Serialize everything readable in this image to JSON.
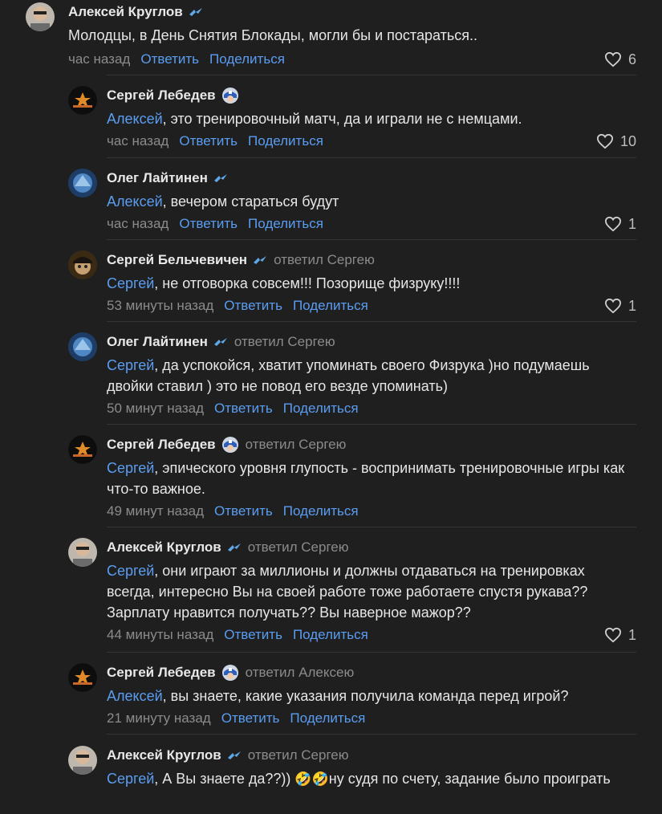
{
  "actions": {
    "reply": "Ответить",
    "share": "Поделиться"
  },
  "comments": [
    {
      "author": "Алексей Круглов",
      "badge": "zenit-icon",
      "replied_to": "",
      "mention": "",
      "text": "Молодцы, в День Снятия Блокады, могли бы и постараться..",
      "time": "час назад",
      "likes": "6"
    },
    {
      "author": "Сергей Лебедев",
      "badge": "captain-america-icon",
      "replied_to": "",
      "mention": "Алексей",
      "text": ", это тренировочный матч, да и играли не с немцами.",
      "time": "час назад",
      "likes": "10"
    },
    {
      "author": "Олег Лайтинен",
      "badge": "zenit-icon",
      "replied_to": "",
      "mention": "Алексей",
      "text": ", вечером стараться будут",
      "time": "час назад",
      "likes": "1"
    },
    {
      "author": "Сергей Бельчевичен",
      "badge": "zenit-icon",
      "replied_to": "ответил Сергею",
      "mention": "Сергей",
      "text": ", не отговорка совсем!!! Позорище физруку!!!!",
      "time": "53 минуты назад",
      "likes": "1"
    },
    {
      "author": "Олег Лайтинен",
      "badge": "zenit-icon",
      "replied_to": "ответил Сергею",
      "mention": "Сергей",
      "text": ", да успокойся, хватит упоминать своего Физрука )но подумаешь двойки ставил ) это не повод его везде упоминать)",
      "time": "50 минут назад",
      "likes": ""
    },
    {
      "author": "Сергей Лебедев",
      "badge": "captain-america-icon",
      "replied_to": "ответил Сергею",
      "mention": "Сергей",
      "text": ", эпического уровня глупость - воспринимать тренировочные игры как что-то важное.",
      "time": "49 минут назад",
      "likes": ""
    },
    {
      "author": "Алексей Круглов",
      "badge": "zenit-icon",
      "replied_to": "ответил Сергею",
      "mention": "Сергей",
      "text": ", они играют за миллионы и должны отдаваться на тренировках всегда, интересно Вы на своей работе тоже работаете спустя рукава?? Зарплату нравится получать?? Вы наверное мажор??",
      "time": "44 минуты назад",
      "likes": "1"
    },
    {
      "author": "Сергей Лебедев",
      "badge": "captain-america-icon",
      "replied_to": "ответил Алексею",
      "mention": "Алексей",
      "text": ", вы знаете, какие указания получила команда перед игрой?",
      "time": "21 минуту назад",
      "likes": ""
    },
    {
      "author": "Алексей Круглов",
      "badge": "zenit-icon",
      "replied_to": "ответил Сергею",
      "mention": "Сергей",
      "text": ", А Вы знаете да??)) ",
      "text_after_emoji": "ну судя по счету, задание было проиграть",
      "emoji": "🤣🤣",
      "time": "",
      "likes": ""
    }
  ],
  "colors": {
    "background": "#1f1f20",
    "link": "#5a9df0",
    "muted": "#8b8b8b",
    "divider": "#353535"
  }
}
